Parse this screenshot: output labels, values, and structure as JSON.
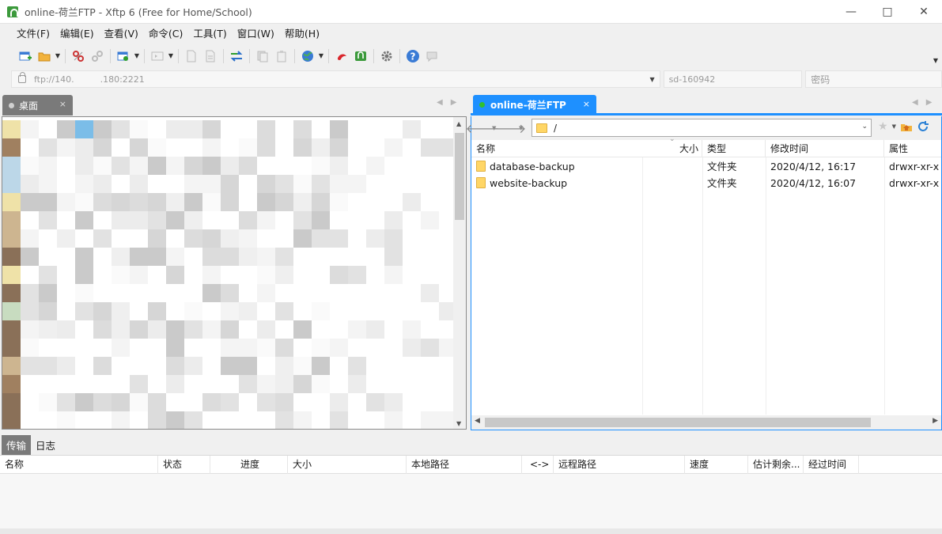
{
  "window": {
    "title": "online-荷兰FTP - Xftp 6 (Free for Home/School)"
  },
  "menu": [
    "文件(F)",
    "编辑(E)",
    "查看(V)",
    "命令(C)",
    "工具(T)",
    "窗口(W)",
    "帮助(H)"
  ],
  "address": {
    "host": "ftp://140.   .180:2221",
    "username": "sd-160942",
    "password_placeholder": "密码"
  },
  "left_panel": {
    "tab_label": "桌面"
  },
  "right_panel": {
    "tab_label": "online-荷兰FTP",
    "path": "/",
    "columns": [
      "名称",
      "大小",
      "类型",
      "修改时间",
      "属性"
    ],
    "files": [
      {
        "name": "database-backup",
        "size": "",
        "type": "文件夹",
        "modified": "2020/4/12, 16:17",
        "attributes": "drwxr-xr-x"
      },
      {
        "name": "website-backup",
        "size": "",
        "type": "文件夹",
        "modified": "2020/4/12, 16:07",
        "attributes": "drwxr-xr-x"
      }
    ]
  },
  "bottom": {
    "tabs": [
      "传输",
      "日志"
    ],
    "columns": [
      "名称",
      "状态",
      "进度",
      "大小",
      "本地路径",
      "<->",
      "远程路径",
      "速度",
      "估计剩余...",
      "经过时间"
    ]
  },
  "colors": {
    "accent": "#1e90ff",
    "inactive_tab": "#7a7a7a",
    "folder": "#ffd666"
  }
}
